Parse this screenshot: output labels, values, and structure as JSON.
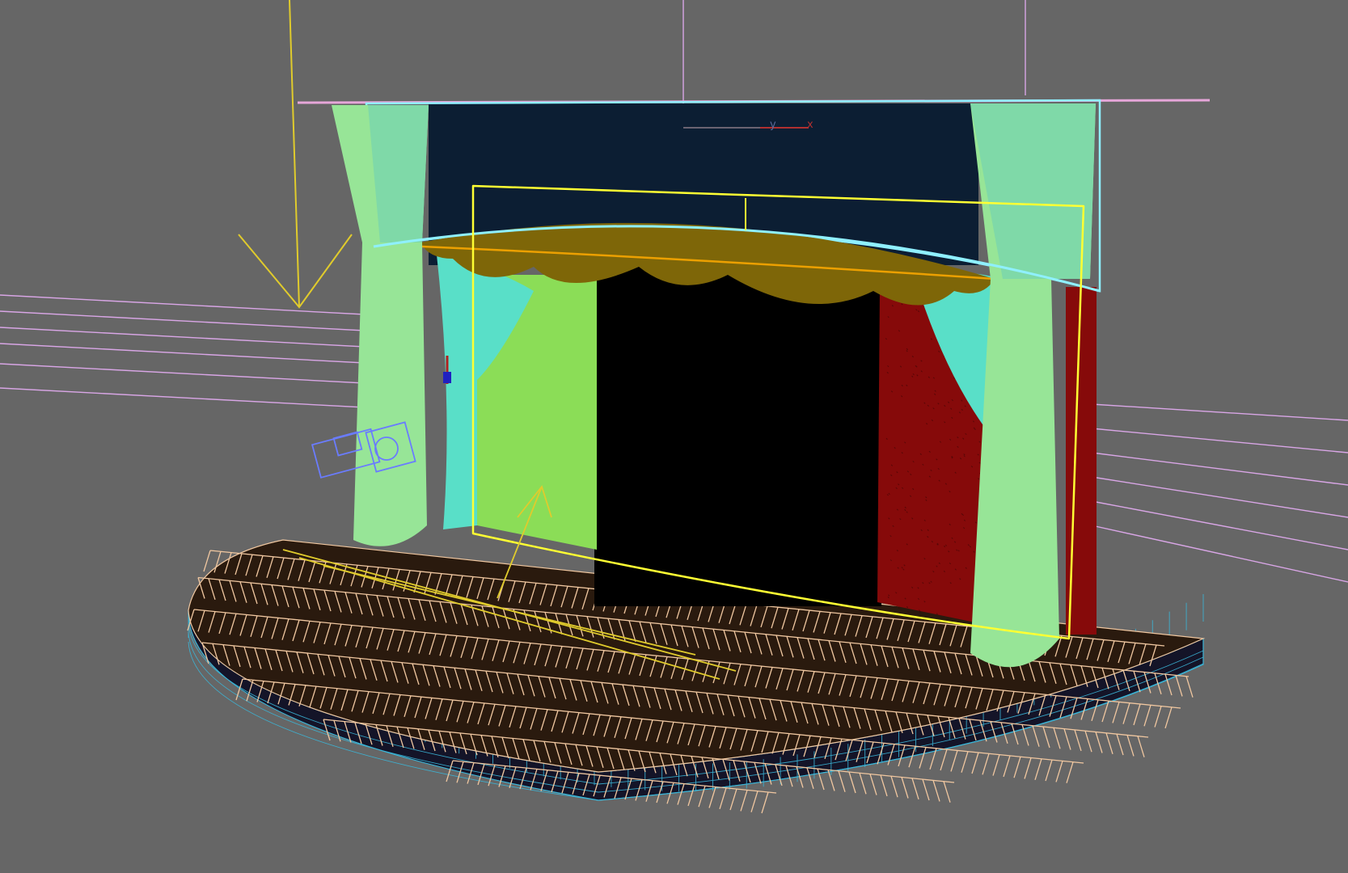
{
  "viewport": {
    "background": "#666666",
    "axis_labels": {
      "y": "y",
      "x": "x"
    }
  },
  "colors": {
    "column": "#97E597",
    "column_shade": "#7FD9A8",
    "backdrop": "#0C1E33",
    "valance": "#7E6608",
    "opening": "#000000",
    "curtain_left": "#8BDD57",
    "curtain_right": "#860A0A",
    "drape": "#59DFC8",
    "floor": "#2A1A0E",
    "floor_lines": "#F0C7A0",
    "stage_rim": "#141428",
    "rim_grid": "#3BB6D8",
    "selection": "#FFFF33",
    "light": "#E0CB2C",
    "camera": "#6A7CFF",
    "guides": "#D9A6E6",
    "top_beam": "#E6A6D9",
    "rail": "#8FF0FF"
  }
}
